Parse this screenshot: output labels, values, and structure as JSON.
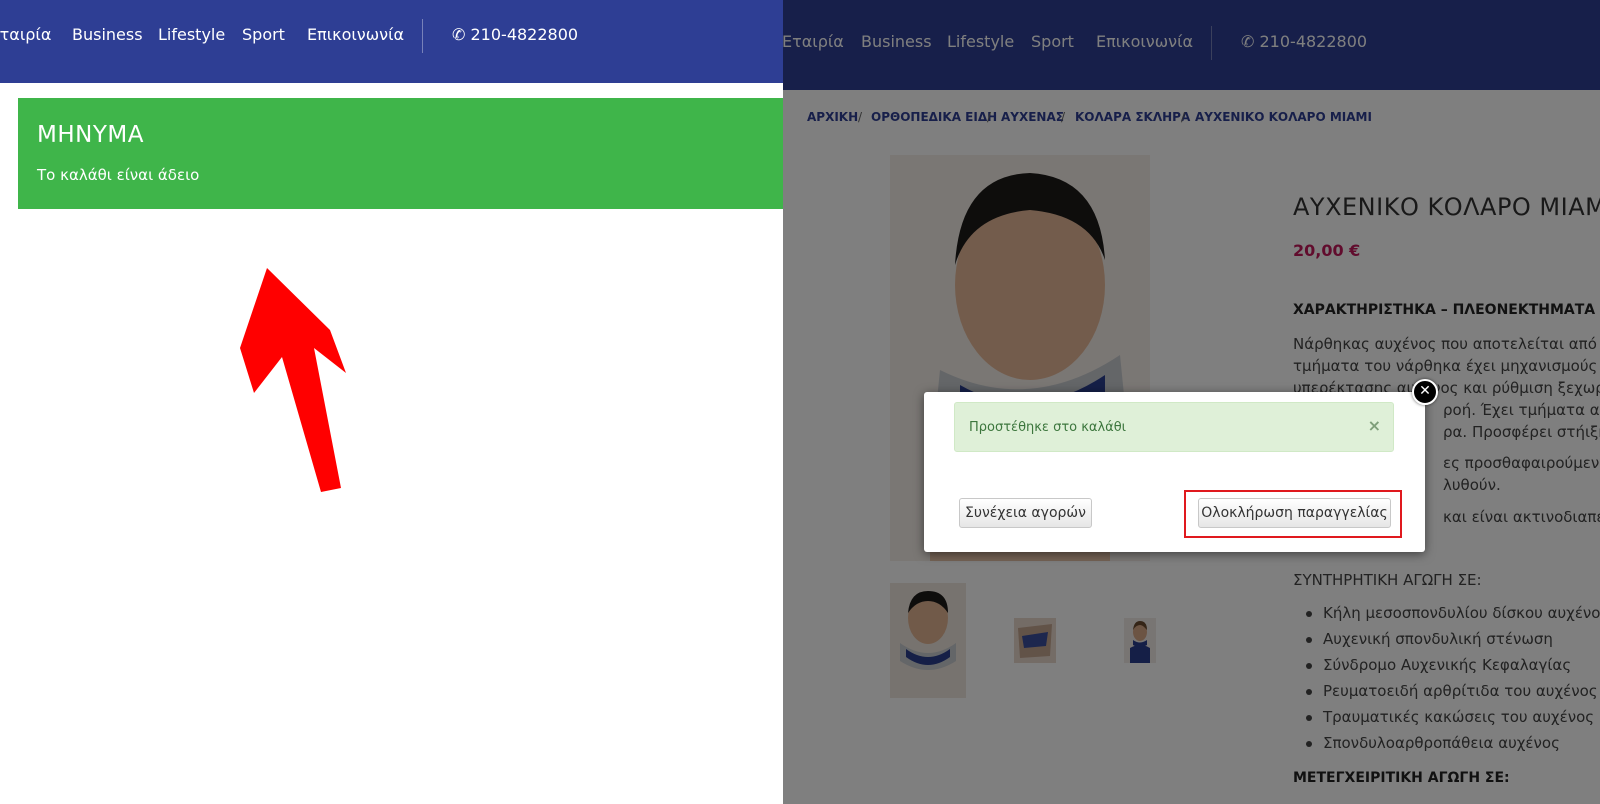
{
  "nav": {
    "items": [
      "Εταιρία",
      "Business",
      "Lifestyle",
      "Sport",
      "Επικοινωνία"
    ],
    "phone": "210-4822800",
    "left_partial_first": "εταιρία"
  },
  "message": {
    "title": "ΜΗΝΥΜΑ",
    "text": "Το καλάθι είναι άδειο"
  },
  "breadcrumb": [
    "ΑΡΧΙΚΗ",
    "ΟΡΘΟΠΕΔΙΚΑ ΕΙΔΗ",
    "ΑΥΧΕΝΑΣ",
    "ΚΟΛΑΡΑ ΣΚΛΗΡΑ",
    "ΑΥΧΕΝΙΚΟ ΚΟΛΑΡΟ ΜΙΑΜΙ"
  ],
  "product": {
    "title": "ΑΥΧΕΝΙΚΟ ΚΟΛΑΡΟ ΜΙΑΜΙ",
    "price": "20,00 €",
    "features_heading": "ΧΑΡΑΚΤΗΡΙΣΤΗΚΑ – ΠΛΕΟΝΕΚΤΗΜΑΤΑ",
    "desc_lines": [
      "Νάρθηκας αυχένος που αποτελείται από δύο",
      "τμήματα του νάρθηκα έχει μηχανισμούς με",
      "υπερέκτασης αυχένος και ρύθμιση ξεχωριστά",
      "ροή. Έχει τμήματα αεροφ",
      "ρα. Προσφέρει στήιξη τ",
      "ες προσθαφαιρούμενες κ",
      "λυθούν.",
      "και είναι ακτινοδιαπερατό"
    ],
    "conservative_heading": "ΣΥΝΤΗΡΗΤΙΚΗ ΑΓΩΓΗ ΣΕ:",
    "conditions": [
      "Κήλη μεσοσπονδυλίου δίσκου αυχένος",
      "Αυχενική σπονδυλική στένωση",
      "Σύνδρομο Αυχενικής Κεφαλαγίας",
      "Ρευματοειδή αρθρίτιδα του αυχένος",
      "Τραυματικές κακώσεις του αυχένος",
      "Σπονδυλοαρθροπάθεια αυχένος"
    ],
    "surgical_heading": "ΜΕΤΕΓΧΕΙΡΙΤΙΚΗ ΑΓΩΓΗ ΣΕ:"
  },
  "modal": {
    "alert_text": "Προστέθηκε στο καλάθι",
    "alert_close": "×",
    "continue_label": "Συνέχεια αγορών",
    "checkout_label": "Ολοκλήρωση παραγγελίας",
    "close_glyph": "✕"
  },
  "colors": {
    "nav_bg": "#2e3e94",
    "message_bg": "#3fb54a",
    "arrow": "#ff0000",
    "highlight": "#e0191e",
    "price": "#c2185b"
  }
}
